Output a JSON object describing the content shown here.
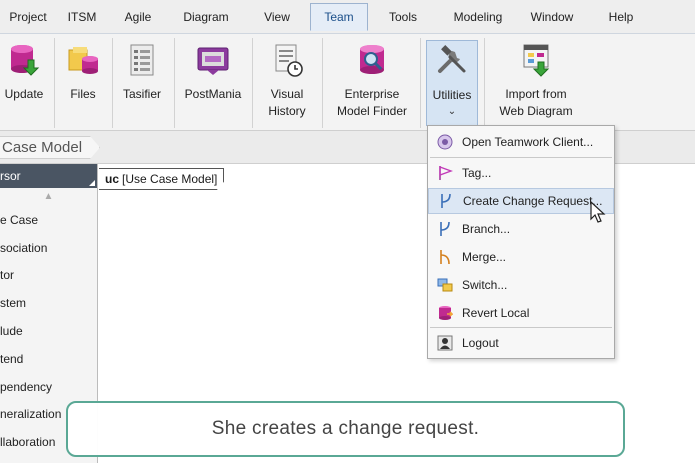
{
  "menubar": {
    "items": [
      "Project",
      "ITSM",
      "Agile",
      "Diagram",
      "View",
      "Team",
      "Tools",
      "Modeling",
      "Window",
      "Help"
    ],
    "active": "Team"
  },
  "ribbon": {
    "buttons": [
      {
        "label": "Update",
        "icon": "database-download-icon"
      },
      {
        "label": "Files",
        "icon": "files-folder-icon"
      },
      {
        "label": "Tasifier",
        "icon": "tasifier-icon"
      },
      {
        "label": "PostMania",
        "icon": "postmania-icon"
      },
      {
        "label": "Visual\nHistory",
        "icon": "visual-history-icon"
      },
      {
        "label": "Enterprise\nModel Finder",
        "icon": "model-finder-icon"
      },
      {
        "label": "Utilities",
        "icon": "tools-icon"
      },
      {
        "label": "Import from\nWeb Diagram",
        "icon": "import-web-diagram-icon"
      }
    ]
  },
  "breadcrumb": {
    "label": "Case Model"
  },
  "palette": {
    "cursor": "rsor",
    "items": [
      "e Case",
      "sociation",
      "tor",
      "stem",
      "lude",
      "tend",
      "pendency",
      "neralization",
      "llaboration"
    ]
  },
  "diagram": {
    "tab_keyword": "uc",
    "tab_name": "[Use Case Model]"
  },
  "dropdown": {
    "items": [
      {
        "label": "Open Teamwork Client...",
        "icon": "teamwork-client-icon"
      },
      {
        "label": "Tag...",
        "icon": "tag-flag-icon"
      },
      {
        "label": "Create Change Request...",
        "icon": "change-request-icon",
        "highlighted": true
      },
      {
        "label": "Branch...",
        "icon": "branch-icon"
      },
      {
        "label": "Merge...",
        "icon": "merge-icon"
      },
      {
        "label": "Switch...",
        "icon": "switch-icon"
      },
      {
        "label": "Revert Local",
        "icon": "revert-local-icon"
      },
      {
        "label": "Logout",
        "icon": "logout-icon"
      }
    ]
  },
  "caption": {
    "text": "She creates a change request."
  },
  "colors": {
    "accent": "#1b4f8a",
    "caption_border": "#5aa895",
    "highlight": "#dce7f4",
    "palette_selected": "#4a5563"
  }
}
